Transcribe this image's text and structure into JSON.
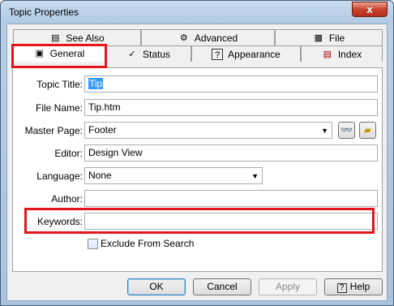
{
  "window": {
    "title": "Topic Properties",
    "close_glyph": "x"
  },
  "tabs": {
    "back": [
      {
        "label": "See Also",
        "icon": "see-also-icon"
      },
      {
        "label": "Advanced",
        "icon": "gear-icon"
      },
      {
        "label": "File",
        "icon": "file-icon"
      }
    ],
    "front": [
      {
        "label": "General",
        "icon": "general-icon"
      },
      {
        "label": "Status",
        "icon": "checkmark-icon"
      },
      {
        "label": "Appearance",
        "icon": "help-icon"
      },
      {
        "label": "Index",
        "icon": "index-icon"
      }
    ]
  },
  "form": {
    "topic_title": {
      "label": "Topic Title:",
      "value": "Tip"
    },
    "file_name": {
      "label": "File Name:",
      "value": "Tip.htm"
    },
    "master_page": {
      "label": "Master Page:",
      "value": "Footer"
    },
    "editor": {
      "label": "Editor:",
      "value": "Design View"
    },
    "language": {
      "label": "Language:",
      "value": "None"
    },
    "author": {
      "label": "Author:",
      "value": ""
    },
    "keywords": {
      "label": "Keywords:",
      "value": ""
    },
    "exclude": {
      "label": "Exclude From Search",
      "checked": false
    }
  },
  "buttons": {
    "ok": "OK",
    "cancel": "Cancel",
    "apply": "Apply",
    "help": "Help"
  },
  "colors": {
    "highlight": "#e3161b",
    "selection": "#3399ff"
  }
}
